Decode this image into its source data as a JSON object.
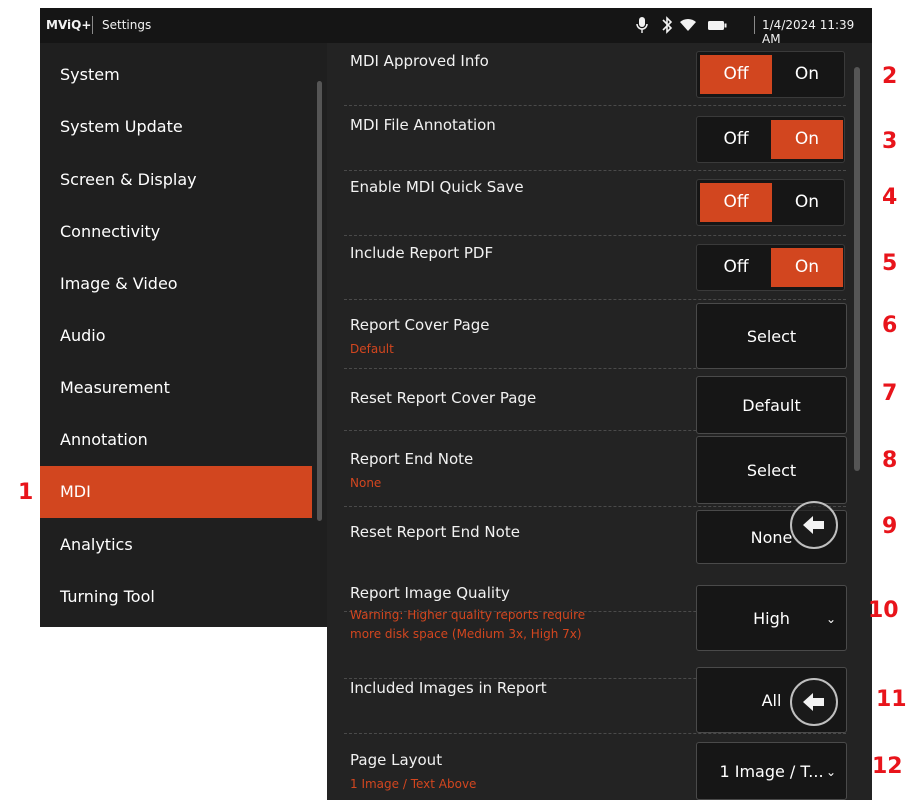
{
  "status_bar": {
    "app": "MViQ+",
    "page": "Settings",
    "datetime": "1/4/2024 11:39 AM",
    "icons": [
      "microphone-icon",
      "bluetooth-icon",
      "wifi-icon",
      "battery-icon"
    ]
  },
  "sidebar": {
    "items": [
      {
        "label": "System"
      },
      {
        "label": "System Update"
      },
      {
        "label": "Screen & Display"
      },
      {
        "label": "Connectivity"
      },
      {
        "label": "Image & Video"
      },
      {
        "label": "Audio"
      },
      {
        "label": "Measurement"
      },
      {
        "label": "Annotation"
      },
      {
        "label": "MDI",
        "active": true
      },
      {
        "label": "Analytics"
      },
      {
        "label": "Turning Tool"
      }
    ]
  },
  "settings": [
    {
      "title": "MDI Approved Info",
      "type": "toggle",
      "off_label": "Off",
      "on_label": "On",
      "selected": "Off"
    },
    {
      "title": "MDI File Annotation",
      "type": "toggle",
      "off_label": "Off",
      "on_label": "On",
      "selected": "On"
    },
    {
      "title": "Enable MDI Quick Save",
      "type": "toggle",
      "off_label": "Off",
      "on_label": "On",
      "selected": "Off"
    },
    {
      "title": "Include Report PDF",
      "type": "toggle",
      "off_label": "Off",
      "on_label": "On",
      "selected": "On"
    },
    {
      "title": "Report Cover Page",
      "subtitle": "Default",
      "type": "button",
      "value": "Select"
    },
    {
      "title": "Reset Report Cover Page",
      "type": "button",
      "value": "Default"
    },
    {
      "title": "Report End Note",
      "subtitle": "None",
      "type": "button",
      "value": "Select"
    },
    {
      "title": "Reset Report End Note",
      "type": "button",
      "value": "None"
    },
    {
      "title": "Report Image Quality",
      "subtitle": "Warning: Higher quality reports require",
      "subtitle2": "more disk space (Medium 3x, High 7x)",
      "type": "select",
      "value": "High"
    },
    {
      "title": "Included Images in Report",
      "type": "button",
      "value": "All"
    },
    {
      "title": "Page Layout",
      "subtitle": "1 Image / Text Above",
      "type": "select",
      "value": "1 Image / T..."
    }
  ],
  "callouts": [
    "1",
    "2",
    "3",
    "4",
    "5",
    "6",
    "7",
    "8",
    "9",
    "10",
    "11",
    "12"
  ],
  "colors": {
    "accent": "#d2461f",
    "callout": "#e8141b",
    "panel": "#232323",
    "sidebar": "#1f1f1f"
  }
}
